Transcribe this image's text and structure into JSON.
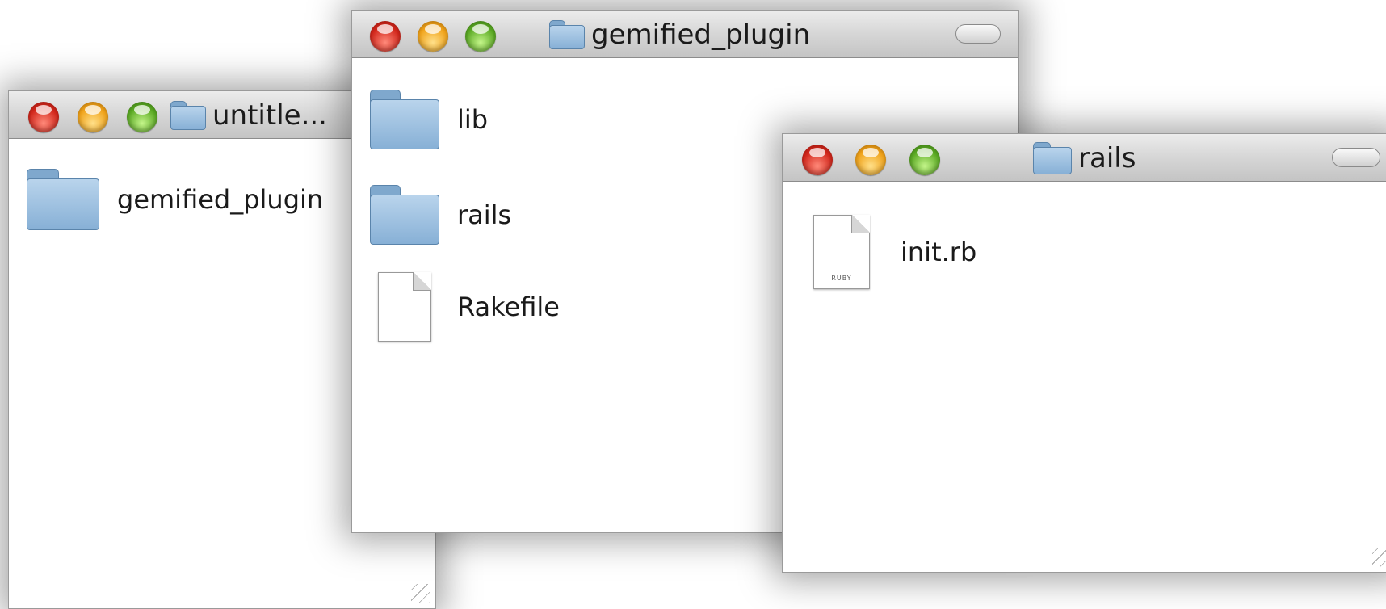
{
  "windows": {
    "untitled": {
      "title": "untitle...",
      "items": [
        {
          "label": "gemified_plugin",
          "icon": "folder-icon"
        }
      ]
    },
    "gemified_plugin": {
      "title": "gemified_plugin",
      "items": [
        {
          "label": "lib",
          "icon": "folder-icon"
        },
        {
          "label": "rails",
          "icon": "folder-icon"
        },
        {
          "label": "Rakefile",
          "icon": "document-icon"
        }
      ]
    },
    "rails": {
      "title": "rails",
      "items": [
        {
          "label": "init.rb",
          "icon": "ruby-file-icon",
          "badge": "RUBY"
        }
      ]
    }
  },
  "colors": {
    "close": "#d2261b",
    "minimize": "#f0a219",
    "zoom": "#5aa923",
    "folder": "#87b0d6"
  }
}
